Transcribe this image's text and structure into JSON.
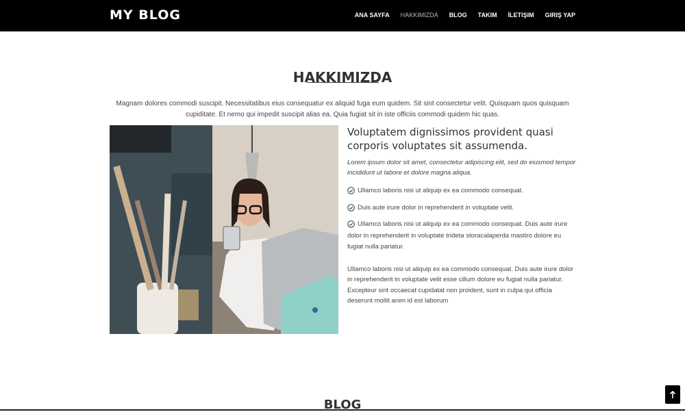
{
  "brand": "MY BLOG",
  "nav": [
    {
      "label": "ANA SAYFA",
      "active": false
    },
    {
      "label": "HAKKIMIZDA",
      "active": true
    },
    {
      "label": "BLOG",
      "active": false
    },
    {
      "label": "TAKIM",
      "active": false
    },
    {
      "label": "İLETIŞIM",
      "active": false
    },
    {
      "label": "GIRIŞ YAP",
      "active": false
    }
  ],
  "about": {
    "title": "HAKKIMIZDA",
    "intro": "Magnam dolores commodi suscipit. Necessitatibus eius consequatur ex aliquid fuga eum quidem. Sit sint consectetur velit. Quisquam quos quisquam cupiditate. Et nemo qui impedit suscipit alias ea. Quia fugiat sit in iste officiis commodi quidem hic quas.",
    "heading": "Voluptatem dignissimos provident quasi corporis voluptates sit assumenda.",
    "lead": "Lorem ipsum dolor sit amet, consectetur adipiscing elit, sed do eiusmod tempor incididunt ut labore et dolore magna aliqua.",
    "items": [
      "Ullamco laboris nisi ut aliquip ex ea commodo consequat.",
      "Duis aute irure dolor in reprehenderit in voluptate velit.",
      "Ullamco laboris nisi ut aliquip ex ea commodo consequat. Duis aute irure dolor in reprehenderit in voluptate trideta storacalaperda mastiro dolore eu fugiat nulla pariatur."
    ],
    "paragraph": "Ullamco laboris nisi ut aliquip ex ea commodo consequat. Duis aute irure dolor in reprehenderit in voluptate velit esse cillum dolore eu fugiat nulla pariatur. Excepteur sint occaecat cupidatat non proident, sunt in culpa qui officia deserunt mollit anim id est laborum"
  },
  "blog": {
    "title": "BLOG"
  },
  "icons": {
    "check": "check-circle-icon",
    "back_to_top": "arrow-up-icon"
  }
}
